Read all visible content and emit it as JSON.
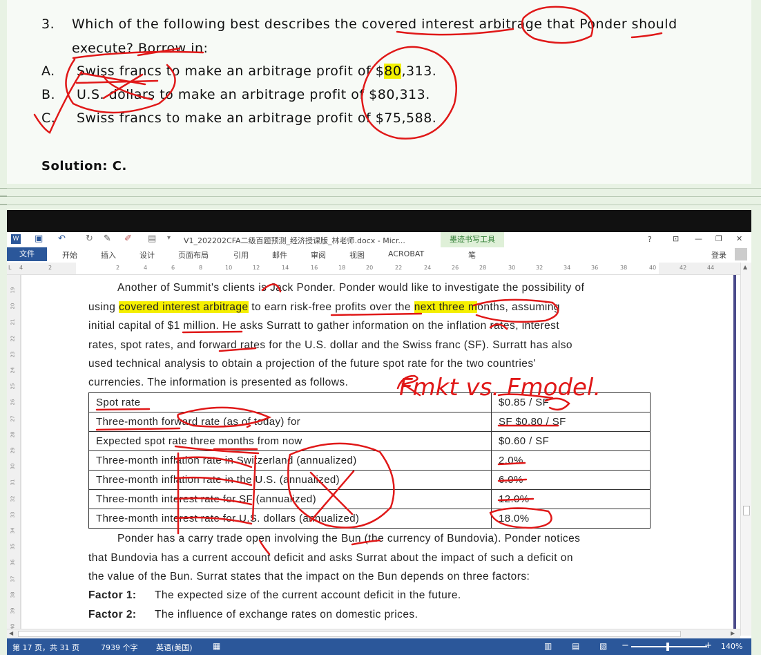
{
  "question": {
    "number": "3.",
    "stem_line1": "Which of the following best describes the covered interest arbitrage that Ponder should",
    "stem_line2": "execute? Borrow in:",
    "options": [
      {
        "letter": "A.",
        "text_pre": "Swiss francs to make an arbitrage profit of $",
        "text_hl": "80",
        "text_post": ",313."
      },
      {
        "letter": "B.",
        "text_pre": "U.S. dollars to make an arbitrage profit of $80,313.",
        "text_hl": "",
        "text_post": ""
      },
      {
        "letter": "C.",
        "text_pre": "Swiss francs to make an arbitrage profit of $75,588.",
        "text_hl": "",
        "text_post": ""
      }
    ],
    "solution": "Solution: C."
  },
  "word": {
    "title": "V1_202202CFA二级百题预测_经济授课版_林老师.docx - Micr...",
    "contextual_tab": "墨迹书写工具",
    "contextual_sub": "笔",
    "window_controls": [
      "?",
      "⊡",
      "—",
      "❐",
      "✕"
    ],
    "login": "登录",
    "tabs": [
      "文件",
      "开始",
      "插入",
      "设计",
      "页面布局",
      "引用",
      "邮件",
      "审阅",
      "视图",
      "ACROBAT"
    ],
    "ruler_numbers": [
      "4",
      "2",
      "2",
      "4",
      "6",
      "8",
      "10",
      "12",
      "14",
      "16",
      "18",
      "20",
      "22",
      "24",
      "26",
      "28",
      "30",
      "32",
      "34",
      "36",
      "38",
      "40",
      "42",
      "44"
    ],
    "vruler_numbers": [
      "19",
      "20",
      "21",
      "22",
      "23",
      "24",
      "25",
      "26",
      "27",
      "28",
      "29",
      "30",
      "31",
      "32",
      "33",
      "34",
      "35",
      "36",
      "37",
      "38",
      "39",
      "40"
    ],
    "status": {
      "page": "第 17 页，共 31 页",
      "words": "7939 个字",
      "lang": "英语(美国)",
      "zoom": "140%"
    }
  },
  "document": {
    "para1": [
      {
        "pre": "Another of Summit's clients is Jack Ponder. Ponder would like to investigate the possibility of",
        "hl": "",
        "post": ""
      },
      {
        "pre": "using ",
        "hl": "covered interest arbitrage",
        "post": " to earn risk-free profits over the ",
        "hl2": "next three m",
        "post2": "onths, assuming"
      },
      {
        "pre": "initial capital of $1 million. He asks Surratt to gather information on the inflation rates, interest",
        "hl": "",
        "post": ""
      },
      {
        "pre": "rates, spot rates, and forward rates for the U.S. dollar and the Swiss franc (SF). Surratt has also",
        "hl": "",
        "post": ""
      },
      {
        "pre": "used technical analysis to obtain a projection of the future spot rate for the two countries'",
        "hl": "",
        "post": ""
      },
      {
        "pre": "currencies. The information is presented as follows.",
        "hl": "",
        "post": ""
      }
    ],
    "table": [
      {
        "label": "Spot rate",
        "value": "$0.85 / SF"
      },
      {
        "label": "Three-month forward rate (as of today) for",
        "value": "SF $0.80 / SF"
      },
      {
        "label": "Expected spot rate three months from now",
        "value": "$0.60 / SF"
      },
      {
        "label": "Three-month inflation rate in Switzerland (annualized)",
        "value": "2.0%"
      },
      {
        "label": "Three-month inflation rate in the U.S. (annualized)",
        "value": "6.0%"
      },
      {
        "label": "Three-month interest rate for SF (annualized)",
        "value": "12.0%"
      },
      {
        "label": "Three-month interest rate for U.S. dollars (annualized)",
        "value": "18.0%"
      }
    ],
    "para2": [
      "Ponder has a carry trade open involving the Bun (the currency of Bundovia). Ponder notices",
      "that Bundovia has a current account deficit and asks Surrat about the impact of such a deficit on",
      "the value of the Bun. Surrat states that the impact on the Bun depends on three factors:"
    ],
    "factors": [
      {
        "label": "Factor 1:",
        "text": "The expected size of the current account deficit in the future."
      },
      {
        "label": "Factor 2:",
        "text": "The influence of exchange rates on domestic prices."
      }
    ],
    "handwriting": "Fmkt vs. Fmodel."
  },
  "colors": {
    "ink": "#e01818",
    "highlight": "#f5ef00",
    "word_blue": "#2b579a"
  }
}
